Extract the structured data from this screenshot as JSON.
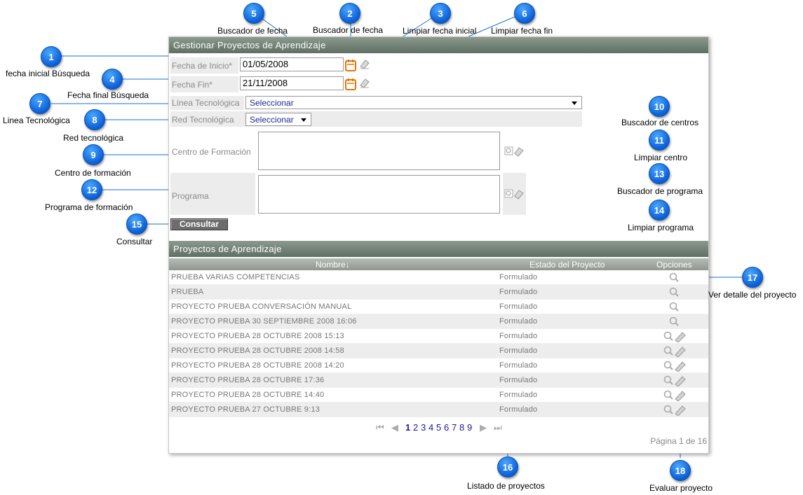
{
  "form": {
    "title": "Gestionar Proyectos de Aprendizaje",
    "fecha_inicio_label": "Fecha de Inicio*",
    "fecha_inicio_value": "01/05/2008",
    "fecha_fin_label": "Fecha Fin*",
    "fecha_fin_value": "21/11/2008",
    "linea_label": "Línea Tecnológica",
    "linea_value": "Seleccionar",
    "red_label": "Red Tecnológica",
    "red_value": "Seleccionar",
    "centro_label": "Centro de Formación",
    "programa_label": "Programa",
    "consultar_label": "Consultar"
  },
  "table": {
    "title": "Proyectos de Aprendizaje",
    "columns": [
      "Nombre↓",
      "Estado del Proyecto",
      "Opciones"
    ],
    "rows": [
      {
        "nombre": "PRUEBA VARIAS COMPETENCIAS",
        "estado": "Formulado",
        "evaluar": false
      },
      {
        "nombre": "PRUEBA",
        "estado": "Formulado",
        "evaluar": false
      },
      {
        "nombre": "PROYECTO PRUEBA CONVERSACIÓN MANUAL",
        "estado": "Formulado",
        "evaluar": false
      },
      {
        "nombre": "PROYECTO PRUEBA 30 SEPTIEMBRE 2008 16:06",
        "estado": "Formulado",
        "evaluar": false
      },
      {
        "nombre": "PROYECTO PRUEBA 28 OCTUBRE 2008 15:13",
        "estado": "Formulado",
        "evaluar": true
      },
      {
        "nombre": "PROYECTO PRUEBA 28 OCTUBRE 2008 14:58",
        "estado": "Formulado",
        "evaluar": true
      },
      {
        "nombre": "PROYECTO PRUEBA 28 OCTUBRE 2008 14:20",
        "estado": "Formulado",
        "evaluar": true
      },
      {
        "nombre": "PROYECTO PRUEBA 28 OCTUBRE 17:36",
        "estado": "Formulado",
        "evaluar": true
      },
      {
        "nombre": "PROYECTO PRUEBA 28 OCTUBRE 14:40",
        "estado": "Formulado",
        "evaluar": true
      },
      {
        "nombre": "PROYECTO PRUEBA 27 OCTUBRE 9:13",
        "estado": "Formulado",
        "evaluar": true
      }
    ],
    "pages": [
      "1",
      "2",
      "3",
      "4",
      "5",
      "6",
      "7",
      "8",
      "9"
    ],
    "page_info": "Página 1 de 16"
  },
  "annotations": [
    {
      "n": "1",
      "label": "fecha inicial Búsqueda"
    },
    {
      "n": "2",
      "label": "Buscador de fecha"
    },
    {
      "n": "3",
      "label": "Limpiar fecha inicial"
    },
    {
      "n": "4",
      "label": "Fecha final Búsqueda"
    },
    {
      "n": "5",
      "label": "Buscador de fecha"
    },
    {
      "n": "6",
      "label": "Limpiar fecha fin"
    },
    {
      "n": "7",
      "label": "Linea Tecnológica"
    },
    {
      "n": "8",
      "label": "Red tecnológica"
    },
    {
      "n": "9",
      "label": "Centro de formación"
    },
    {
      "n": "10",
      "label": "Buscador de centros"
    },
    {
      "n": "11",
      "label": "Limpiar centro"
    },
    {
      "n": "12",
      "label": "Programa de formación"
    },
    {
      "n": "13",
      "label": "Buscador de programa"
    },
    {
      "n": "14",
      "label": "Limpiar programa"
    },
    {
      "n": "15",
      "label": "Consultar"
    },
    {
      "n": "16",
      "label": "Listado de proyectos"
    },
    {
      "n": "17",
      "label": "Ver detalle del proyecto"
    },
    {
      "n": "18",
      "label": "Evaluar proyecto"
    }
  ],
  "colors": {
    "badge": "#0a6ae0",
    "header": "#6b7a6e",
    "link": "#1a1aa8"
  }
}
